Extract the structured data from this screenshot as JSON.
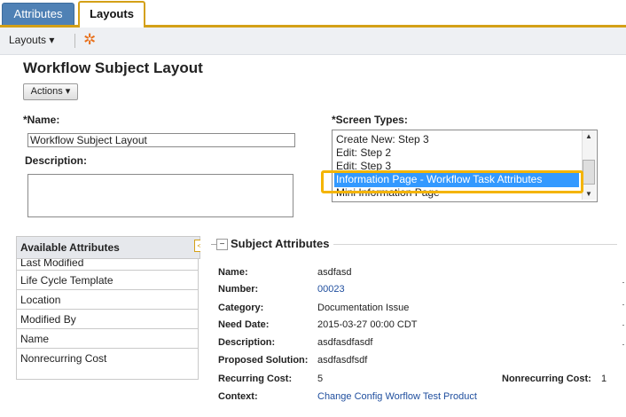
{
  "tabs": [
    {
      "label": "Attributes",
      "active": false
    },
    {
      "label": "Layouts",
      "active": true
    }
  ],
  "toolbar": {
    "layouts_label": "Layouts ▾",
    "refresh_icon": "orange-asterisk-icon"
  },
  "page": {
    "title": "Workflow Subject Layout",
    "actions_label": "Actions ▾"
  },
  "form": {
    "name_label": "Name:",
    "name_value": "Workflow Subject Layout",
    "description_label": "Description:",
    "description_value": "",
    "screen_types_label": "Screen Types:",
    "screen_types": [
      "Create New: Step 3",
      "Edit: Step 2",
      "Edit: Step 3",
      "Information Page - Workflow Task Attributes",
      "Mini Information Page"
    ],
    "screen_types_selected": "Information Page - Workflow Task Attributes"
  },
  "available_attributes": {
    "header": "Available Attributes",
    "items": [
      "Last Modified",
      "Life Cycle Template",
      "Location",
      "Modified By",
      "Name",
      "Nonrecurring Cost"
    ]
  },
  "subject_attributes": {
    "title": "Subject Attributes",
    "fields": [
      {
        "label": "Name:",
        "value": "asdfasd"
      },
      {
        "label": "Number:",
        "value": "00023"
      },
      {
        "label": "Category:",
        "value": "Documentation Issue"
      },
      {
        "label": "Need Date:",
        "value": "2015-03-27 00:00 CDT"
      },
      {
        "label": "Description:",
        "value": "asdfasdfasdf"
      },
      {
        "label": "Proposed Solution:",
        "value": "asdfasdfsdf"
      },
      {
        "label": "Recurring Cost:",
        "value": "5"
      },
      {
        "label": "Context:",
        "value": "Change Config Worflow Test Product"
      }
    ],
    "nonrecurring_label": "Nonrecurring Cost:",
    "nonrecurring_value": "1"
  },
  "colors": {
    "accent": "#d4a017",
    "tab_blue": "#4f81b5",
    "selection": "#3399ff",
    "highlight": "#f4b400",
    "link": "#1f4e9e"
  }
}
